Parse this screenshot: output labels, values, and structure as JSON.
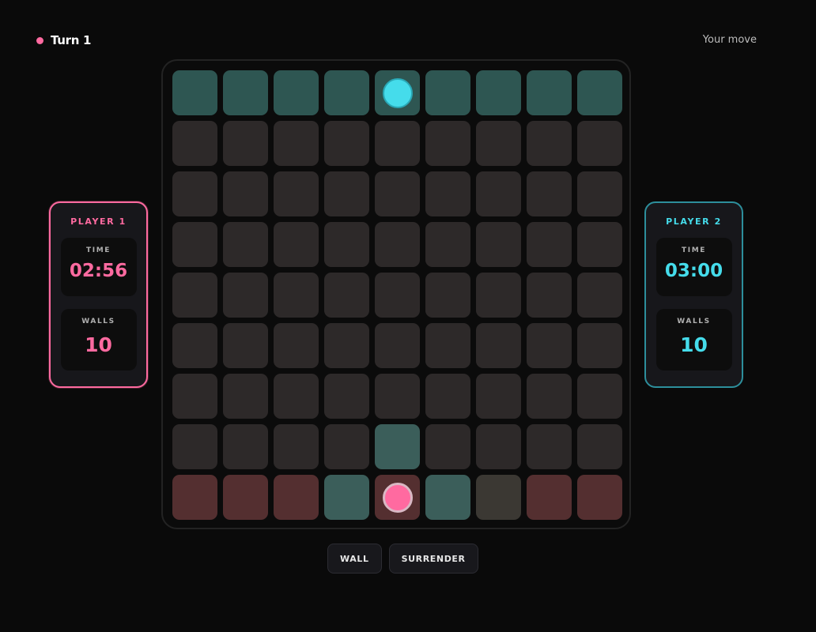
{
  "header": {
    "turn_label": "Turn 1",
    "status": "Your move"
  },
  "colors": {
    "player1": "#ff6aa0",
    "player2": "#45dceb",
    "cell": "#2d2929",
    "goal_top": "#2e5652",
    "goal_bottom": "#542f30",
    "valid_move": "#3b5e5a"
  },
  "board": {
    "size": 9,
    "player1_pawn": {
      "row": 8,
      "col": 4
    },
    "player2_pawn": {
      "row": 0,
      "col": 4
    },
    "valid_moves": [
      {
        "row": 7,
        "col": 4
      },
      {
        "row": 8,
        "col": 3
      },
      {
        "row": 8,
        "col": 5
      }
    ],
    "muted_cells": [
      {
        "row": 8,
        "col": 6
      }
    ]
  },
  "players": [
    {
      "name": "PLAYER 1",
      "time_label": "TIME",
      "time": "02:56",
      "walls_label": "WALLS",
      "walls": "10"
    },
    {
      "name": "PLAYER 2",
      "time_label": "TIME",
      "time": "03:00",
      "walls_label": "WALLS",
      "walls": "10"
    }
  ],
  "actions": {
    "wall_label": "WALL",
    "surrender_label": "SURRENDER"
  }
}
